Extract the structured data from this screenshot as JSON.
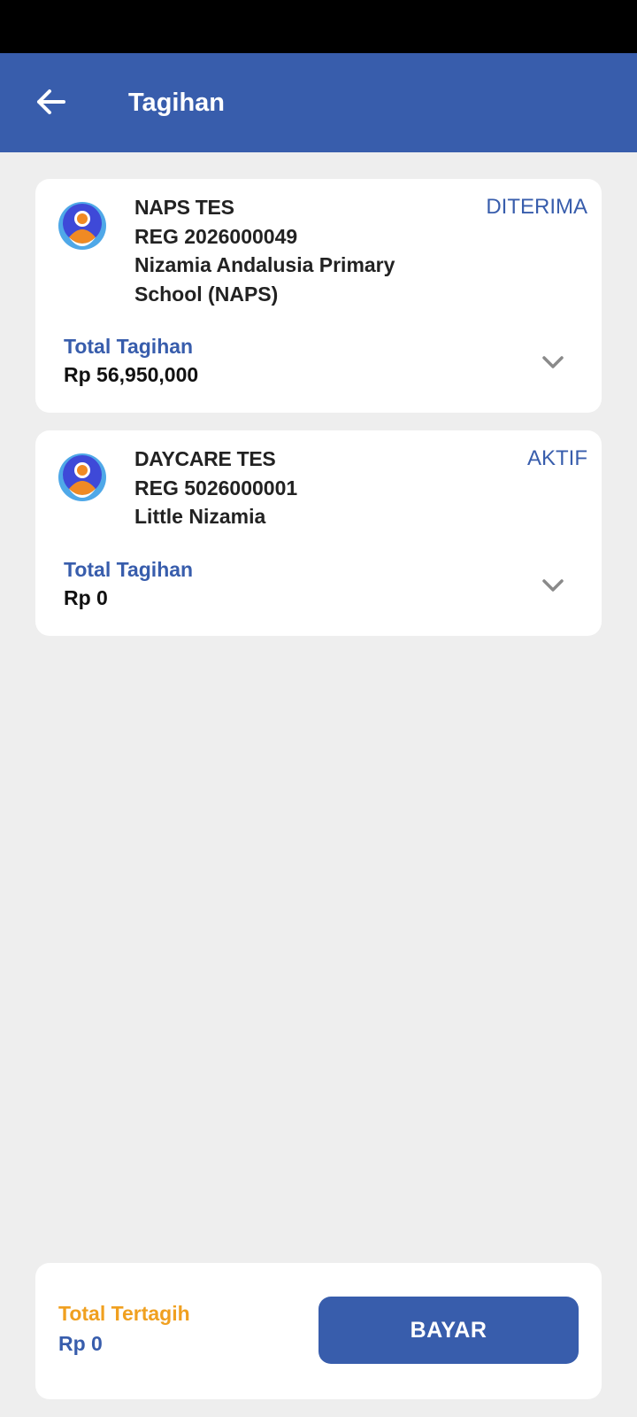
{
  "app_bar": {
    "title": "Tagihan"
  },
  "icons": {
    "back": "arrow-left-icon",
    "avatar": "user-avatar-icon",
    "expand": "chevron-down-icon"
  },
  "colors": {
    "primary": "#385dac",
    "accent": "#f0a020",
    "background": "#eeeeee",
    "avatar_ring": "#4fa8e8",
    "avatar_inner": "#3e49d8",
    "avatar_person": "#f08a24"
  },
  "bills": [
    {
      "name": "NAPS TES",
      "reg": "REG 2026000049",
      "school": "Nizamia Andalusia Primary School (NAPS)",
      "status": "DITERIMA",
      "total_label": "Total Tagihan",
      "total_value": "Rp 56,950,000"
    },
    {
      "name": "DAYCARE TES",
      "reg": "REG 5026000001",
      "school": "Little Nizamia",
      "status": "AKTIF",
      "total_label": "Total Tagihan",
      "total_value": "Rp 0"
    }
  ],
  "footer": {
    "billed_label": "Total Tertagih",
    "billed_value": "Rp 0",
    "pay_label": "BAYAR"
  }
}
